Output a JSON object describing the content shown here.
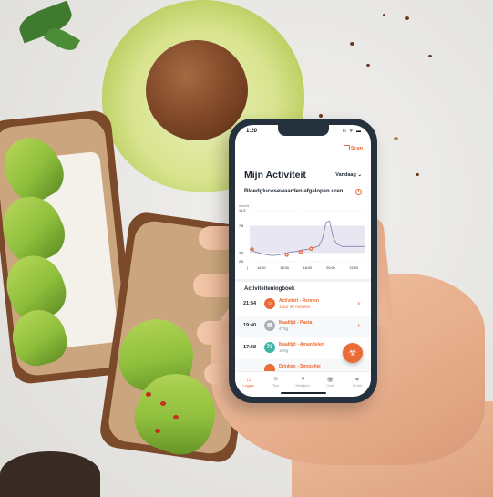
{
  "status_bar": {
    "time": "1:20",
    "icons": "ıl ᯤ ▬"
  },
  "header": {
    "scan_label": "Scan",
    "title": "Mijn Activiteit",
    "period_select": "Vandaag ⌄"
  },
  "chart_card": {
    "title": "Bloedglucosewaarden afgelopen uren",
    "info_icon": "info-icon",
    "unit": "mmol/L"
  },
  "chart_data": {
    "type": "line",
    "ylabel": "mmol/L",
    "ylim": [
      2.6,
      10.0
    ],
    "yticks": [
      10.0,
      7.8,
      3.9,
      2.6
    ],
    "x_ticks": [
      "14:00",
      "16:00",
      "18:00",
      "20:00",
      "22:00"
    ],
    "target_range": [
      3.9,
      7.8
    ],
    "series": [
      {
        "values": [
          [
            13.0,
            4.4
          ],
          [
            13.5,
            4.0
          ],
          [
            14.0,
            3.8
          ],
          [
            14.5,
            3.6
          ],
          [
            15.0,
            3.5
          ],
          [
            15.5,
            3.6
          ],
          [
            16.0,
            3.8
          ],
          [
            16.5,
            4.0
          ],
          [
            17.0,
            4.1
          ],
          [
            17.5,
            4.3
          ],
          [
            18.0,
            4.4
          ],
          [
            18.5,
            4.6
          ],
          [
            19.0,
            4.9
          ],
          [
            19.3,
            6.0
          ],
          [
            19.6,
            8.3
          ],
          [
            19.9,
            8.5
          ],
          [
            20.2,
            6.2
          ],
          [
            20.5,
            5.2
          ],
          [
            21.0,
            4.8
          ],
          [
            21.5,
            4.8
          ],
          [
            22.0,
            4.8
          ],
          [
            22.5,
            4.8
          ],
          [
            23.0,
            4.8
          ]
        ]
      }
    ],
    "markers": [
      {
        "x": 13.2,
        "y": 4.4
      },
      {
        "x": 16.2,
        "y": 3.6
      },
      {
        "x": 17.4,
        "y": 4.0
      },
      {
        "x": 18.3,
        "y": 4.5
      }
    ],
    "colors": {
      "line": "#8d84b5",
      "marker": "#ea6b35",
      "band": "#e8e6f1"
    }
  },
  "log": {
    "title": "Activiteitenlogboek",
    "entries": [
      {
        "time": "21:54",
        "name": "Activiteit - Rennen",
        "detail": "1 uur 30 minuten",
        "icon": "runner-icon",
        "glyph": "☼",
        "color": "#ea6b35",
        "detail_tone": "accent"
      },
      {
        "time": "19:40",
        "name": "Maaltijd - Pasta",
        "detail": "475g",
        "icon": "meal-icon",
        "glyph": "▤",
        "color": "#a9b0b7",
        "detail_tone": "gray"
      },
      {
        "time": "17:58",
        "name": "Maaltijd - Amandelen",
        "detail": "100g",
        "icon": "meal-icon",
        "glyph": "73",
        "color": "#3fb5a4",
        "detail_tone": "gray"
      },
      {
        "time": "",
        "name": "Drinken - Smoothie",
        "detail": "",
        "icon": "drink-icon",
        "glyph": "",
        "color": "#ea6b35",
        "detail_tone": "gray"
      }
    ]
  },
  "fab": {
    "icon": "walking-person-icon",
    "glyph": "🚶"
  },
  "tabs": [
    {
      "label": "Loggen",
      "icon": "home-icon",
      "glyph": "⌂",
      "active": true
    },
    {
      "label": "Tips",
      "icon": "lightbulb-icon",
      "glyph": "☀",
      "active": false
    },
    {
      "label": "Metkijken",
      "icon": "heart-icon",
      "glyph": "♥",
      "active": false
    },
    {
      "label": "Chat",
      "icon": "chat-icon",
      "glyph": "◉",
      "active": false
    },
    {
      "label": "Profiel",
      "icon": "profile-icon",
      "glyph": "●",
      "active": false
    }
  ]
}
